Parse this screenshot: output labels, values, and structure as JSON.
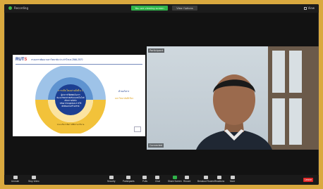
{
  "topbar": {
    "recording_label": "Recording",
    "meeting_pill": "You are viewing screen",
    "view_pill": "View Options",
    "view_button": "View"
  },
  "slide": {
    "logo_main": "RUT",
    "logo_accent": "S",
    "heading": "กรอบการพัฒนามหาวิทยาลัย ประจำปี พ.ศ.2566-2570",
    "center_title": "การเติบโตอย่างยั่งยืน 1",
    "center_lines": [
      "ผู้นำการใช้ดิจิทัลในการ",
      "พัฒนาวิทยาศาสตร์และเทคโนโลยี",
      "เพื่อความยั่งยืน",
      "ทรัพยากรมนุษย์และการใช้",
      "ดิจิทัลอย่างสร้างสรรค์"
    ],
    "yellow_note": "ระบบบริหารจัดการที่มีธรรมาภิบาล",
    "side_blue": "ด้านบริหาร",
    "side_gold": "มหาวิทยาลัยสีเขียว"
  },
  "video": {
    "participant_name": "Participant",
    "bottom_label": "Connected"
  },
  "toolbar": {
    "items": [
      {
        "label": "Unmute"
      },
      {
        "label": "Stop Video"
      },
      {
        "label": "Security"
      },
      {
        "label": "Participants"
      },
      {
        "label": "Polls"
      },
      {
        "label": "Chat"
      },
      {
        "label": "Share Screen"
      },
      {
        "label": "Record"
      },
      {
        "label": "Breakout Rooms"
      },
      {
        "label": "Reactions"
      },
      {
        "label": "More"
      }
    ],
    "leave_label": "Leave"
  }
}
